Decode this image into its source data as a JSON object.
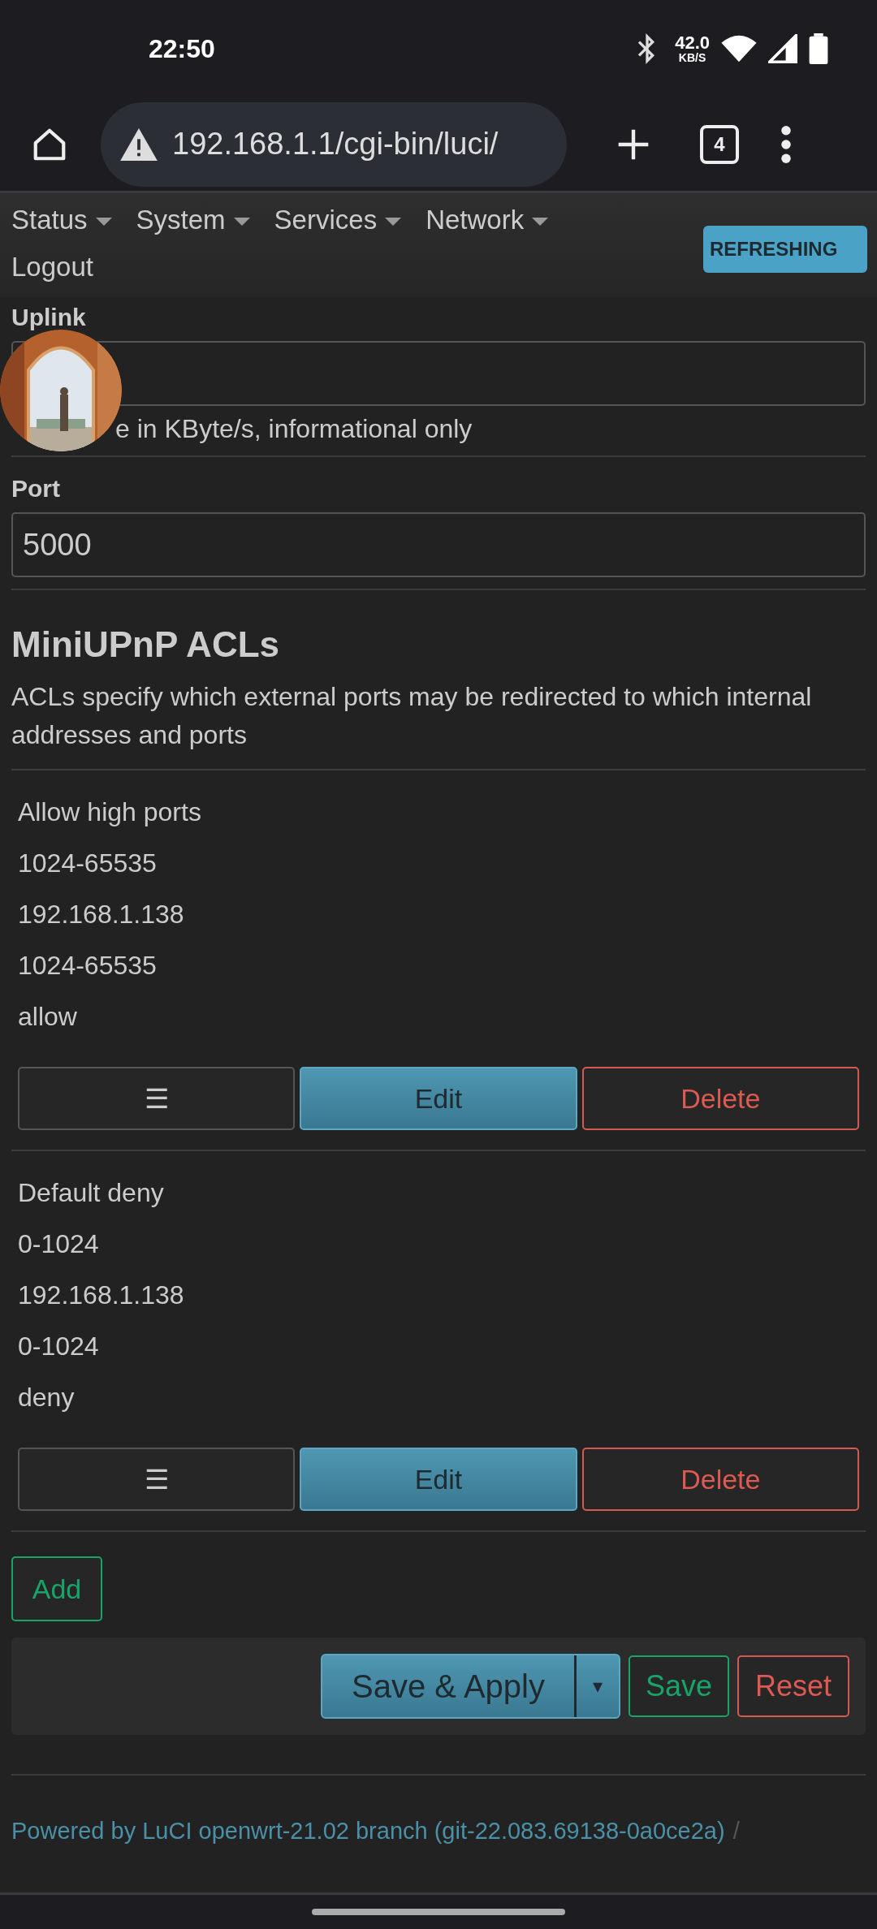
{
  "status_bar": {
    "time": "22:50",
    "net_speed": "42.0",
    "net_unit": "KB/S"
  },
  "browser": {
    "url": "192.168.1.1/cgi-bin/luci/",
    "tab_count": "4"
  },
  "nav": {
    "items": [
      {
        "label": "Status",
        "dropdown": true
      },
      {
        "label": "System",
        "dropdown": true
      },
      {
        "label": "Services",
        "dropdown": true
      },
      {
        "label": "Network",
        "dropdown": true
      },
      {
        "label": "Logout",
        "dropdown": false
      }
    ],
    "indicator": "REFRESHING"
  },
  "uplink": {
    "label": "Uplink",
    "description": "e in KByte/s, informational only"
  },
  "port": {
    "label": "Port",
    "value": "5000"
  },
  "acl": {
    "title": "MiniUPnP ACLs",
    "description": "ACLs specify which external ports may be redirected to which internal addresses and ports",
    "entries": [
      {
        "fields": [
          "Allow high ports",
          "1024-65535",
          "192.168.1.138",
          "1024-65535",
          "allow"
        ],
        "sort": "☰",
        "edit": "Edit",
        "delete": "Delete"
      },
      {
        "fields": [
          "Default deny",
          "0-1024",
          "192.168.1.138",
          "0-1024",
          "deny"
        ],
        "sort": "☰",
        "edit": "Edit",
        "delete": "Delete"
      }
    ],
    "add": "Add"
  },
  "actions": {
    "save_apply": "Save & Apply",
    "dropdown": "▾",
    "save": "Save",
    "reset": "Reset"
  },
  "footer": {
    "text": "Powered by LuCI openwrt-21.02 branch (git-22.083.69138-0a0ce2a)",
    "separator": "/"
  }
}
